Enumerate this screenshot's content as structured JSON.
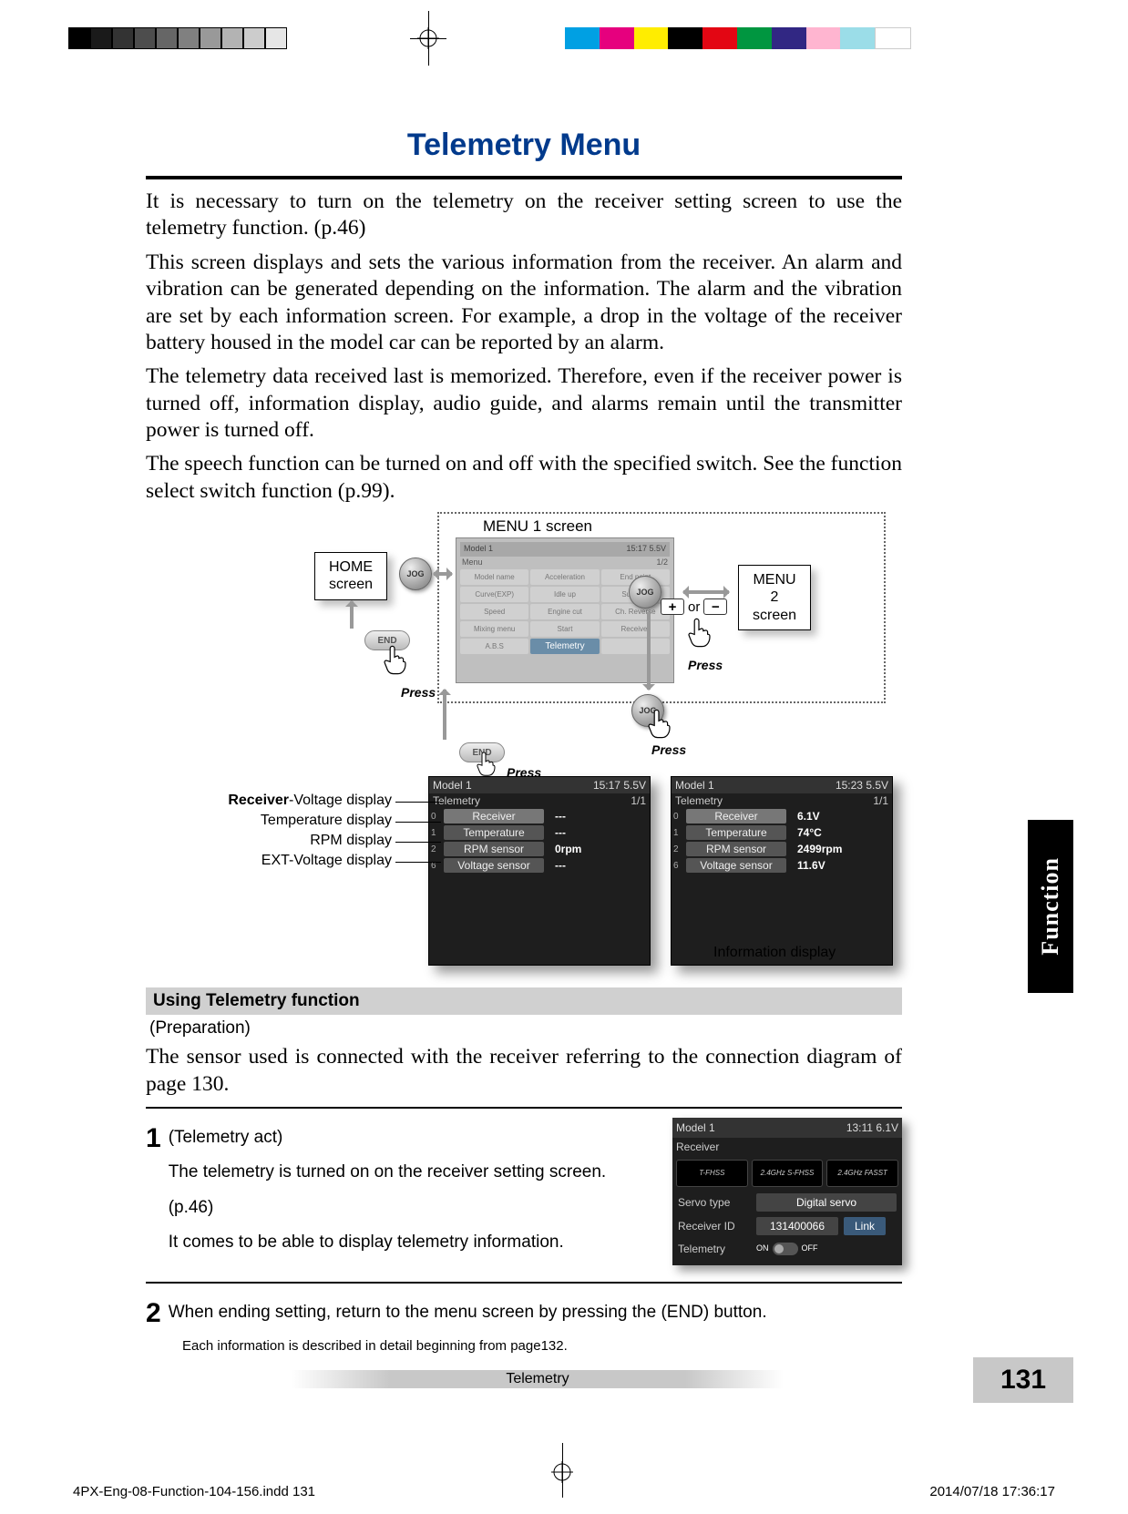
{
  "title": "Telemetry Menu",
  "paragraphs": [
    "It is necessary to turn on the telemetry on the receiver setting screen to use the telemetry function. (p.46)",
    "This screen displays and sets the various information from the receiver. An alarm and vibration can be generated depending on the information. The alarm and the vibration are set by each information screen. For example, a drop in the voltage of the receiver battery housed in the model car can be reported by an alarm.",
    "The telemetry data received last is memorized. Therefore, even if the receiver power is turned off, information display, audio guide, and alarms remain until the transmitter power is turned off.",
    "The speech function can be turned on and off with the specified switch. See the function select switch function (p.99)."
  ],
  "diagram": {
    "menu1_label": "MENU 1 screen",
    "home_box": "HOME screen",
    "menu2_box": "MENU 2 screen",
    "jog_label": "JOG",
    "end_label": "END",
    "press": "Press",
    "or": "or",
    "plus": "+",
    "minus": "−",
    "menu_items": [
      "Model name",
      "Acceleration",
      "End point",
      "Curve(EXP)",
      "Idle up",
      "Sub trim",
      "Speed",
      "Engine cut",
      "Ch. Reverse",
      "Mixing menu",
      "Start",
      "Receiver",
      "A.B.S",
      "Telemetry",
      ""
    ],
    "telemetry_item": "Telemetry",
    "callouts": {
      "receiver": "Receiver-Voltage display",
      "temperature": "Temperature display",
      "rpm": "RPM display",
      "ext": "EXT-Voltage display"
    },
    "screen_left": {
      "model": "Model 1",
      "time": "15:17",
      "batt": "5.5V",
      "title": "Telemetry",
      "page": "1/1",
      "rows": [
        {
          "ix": "0",
          "label": "Receiver",
          "selected": true,
          "value": "---"
        },
        {
          "ix": "1",
          "label": "Temperature",
          "selected": false,
          "value": "---"
        },
        {
          "ix": "2",
          "label": "RPM sensor",
          "selected": false,
          "value": "0rpm"
        },
        {
          "ix": "6",
          "label": "Voltage sensor",
          "selected": false,
          "value": "---"
        }
      ]
    },
    "screen_right": {
      "model": "Model 1",
      "time": "15:23",
      "batt": "5.5V",
      "title": "Telemetry",
      "page": "1/1",
      "rows": [
        {
          "ix": "0",
          "label": "Receiver",
          "selected": true,
          "value": "6.1V"
        },
        {
          "ix": "1",
          "label": "Temperature",
          "selected": false,
          "value": "74°C"
        },
        {
          "ix": "2",
          "label": "RPM sensor",
          "selected": false,
          "value": "2499rpm"
        },
        {
          "ix": "6",
          "label": "Voltage sensor",
          "selected": false,
          "value": "11.6V"
        }
      ]
    },
    "info_display": "Information display"
  },
  "section_heading": "Using Telemetry function",
  "preparation": "(Preparation)",
  "prep_text": "The sensor used is connected with the receiver referring to the connection diagram of page 130.",
  "step1": {
    "num": "1",
    "heading": "(Telemetry act)",
    "lines": [
      "The telemetry is turned on on the receiver setting screen.",
      "(p.46)",
      "It comes to be able to display telemetry information."
    ]
  },
  "receiver_screen": {
    "model": "Model 1",
    "time": "13:11",
    "batt": "6.1V",
    "title": "Receiver",
    "logos": [
      "T-FHSS",
      "2.4GHz S-FHSS",
      "2.4GHz FASST"
    ],
    "servo_type_k": "Servo type",
    "servo_type_v": "Digital servo",
    "receiver_id_k": "Receiver ID",
    "receiver_id_v": "131400066",
    "link": "Link",
    "telemetry_k": "Telemetry",
    "on": "ON",
    "off": "OFF"
  },
  "step2": {
    "num": "2",
    "text": "When ending setting, return to the menu screen by pressing the (END) button.",
    "note": "Each information is described in detail beginning from page132."
  },
  "footer_label": "Telemetry",
  "page_number": "131",
  "side_tab": "Function",
  "slug_left": "4PX-Eng-08-Function-104-156.indd   131",
  "slug_right": "2014/07/18   17:36:17"
}
